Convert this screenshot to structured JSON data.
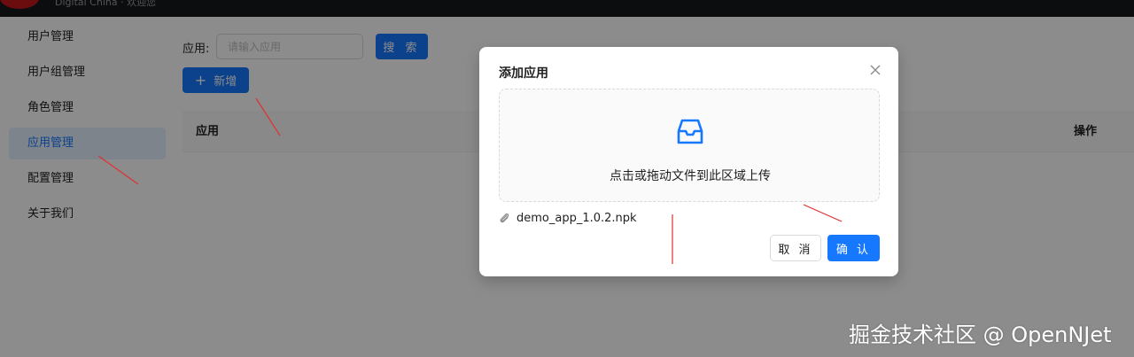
{
  "header": {
    "title": "Digital China · 欢迎您"
  },
  "sidebar": {
    "items": [
      {
        "label": "用户管理",
        "active": false
      },
      {
        "label": "用户组管理",
        "active": false
      },
      {
        "label": "角色管理",
        "active": false
      },
      {
        "label": "应用管理",
        "active": true
      },
      {
        "label": "配置管理",
        "active": false
      },
      {
        "label": "关于我们",
        "active": false
      }
    ]
  },
  "main": {
    "search": {
      "label": "应用:",
      "placeholder": "请输入应用",
      "value": "",
      "button_label": "搜 索"
    },
    "add_button_label": "新增",
    "table": {
      "columns": [
        "应用",
        "操作"
      ]
    }
  },
  "modal": {
    "title": "添加应用",
    "upload_hint": "点击或拖动文件到此区域上传",
    "file_name": "demo_app_1.0.2.npk",
    "cancel_label": "取 消",
    "ok_label": "确 认"
  },
  "watermark": "掘金技术社区 @ OpenNJet",
  "colors": {
    "primary": "#1677ff",
    "header_bg": "#16181d",
    "logo": "#c4161c",
    "annotation_arrow": "#e03030"
  },
  "icons": {
    "add": "plus-icon",
    "close": "close-icon",
    "upload": "inbox-icon",
    "file": "paperclip-icon"
  }
}
